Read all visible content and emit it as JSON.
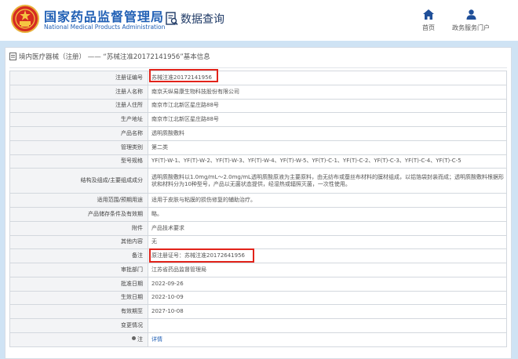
{
  "header": {
    "org_cn": "国家药品监督管理局",
    "org_en": "National Medical Products Administration",
    "section": "数据查询",
    "nav": {
      "home": "首页",
      "portal": "政务服务门户"
    },
    "icons": {
      "emblem": "national-emblem-icon",
      "section": "data-query-icon",
      "home": "home-icon",
      "portal": "user-icon"
    }
  },
  "breadcrumb": {
    "category": "境内医疗器械（注册）",
    "separator": "——",
    "record": "“苏械注准20172141956”基本信息"
  },
  "rows": [
    {
      "label": "注册证编号",
      "value": "苏械注准20172141956"
    },
    {
      "label": "注册人名称",
      "value": "南京天纵易康生物科技股份有限公司"
    },
    {
      "label": "注册人住所",
      "value": "南京市江北新区星庄路88号"
    },
    {
      "label": "生产地址",
      "value": "南京市江北新区星庄路88号"
    },
    {
      "label": "产品名称",
      "value": "透明质酸敷料"
    },
    {
      "label": "管理类别",
      "value": "第二类"
    },
    {
      "label": "型号规格",
      "value": "YF(T)-W-1、YF(T)-W-2、YF(T)-W-3、YF(T)-W-4、YF(T)-W-5、YF(T)-C-1、YF(T)-C-2、YF(T)-C-3、YF(T)-C-4、YF(T)-C-5"
    },
    {
      "label": "结构及组成/主要组成成分",
      "value": "透明质酸敷料以1.0mg/mL～2.0mg/mL透明质酸原液为主要原料，由无纺布或蚕丝布材料的膜材组成，以铝箔袋封装而成；透明质酸敷料根据形状和材料分为10种型号，产品以无菌状态提供，经湿热或辐照灭菌，一次性使用。"
    },
    {
      "label": "适用范围/预期用途",
      "value": "适用于皮肤与粘膜的损伤修复的辅助治疗。"
    },
    {
      "label": "产品储存条件及有效期",
      "value": "略。"
    },
    {
      "label": "附件",
      "value": "产品技术要求"
    },
    {
      "label": "其他内容",
      "value": "无"
    },
    {
      "label": "备注",
      "value": "原注册证号：苏械注准20172641956"
    },
    {
      "label": "审批部门",
      "value": "江苏省药品监督管理局"
    },
    {
      "label": "批准日期",
      "value": "2022-09-26"
    },
    {
      "label": "生效日期",
      "value": "2022-10-09"
    },
    {
      "label": "有效期至",
      "value": "2027-10-08"
    },
    {
      "label": "变更情况",
      "value": ""
    },
    {
      "label": "注",
      "value": "详情"
    }
  ],
  "colors": {
    "brand_blue": "#2160b5",
    "band": "#cfe3f4",
    "highlight": "#e2231a"
  }
}
